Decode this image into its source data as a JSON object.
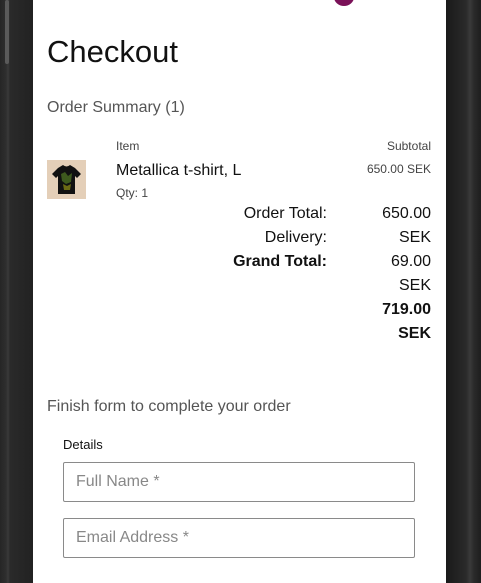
{
  "page": {
    "title": "Checkout",
    "order_summary_heading": "Order Summary (1)"
  },
  "order": {
    "columns": {
      "item": "Item",
      "subtotal": "Subtotal"
    },
    "items": [
      {
        "name": "Metallica t-shirt, L",
        "qty": "Qty: 1",
        "subtotal": "650.00 SEK",
        "image": "black-tshirt"
      }
    ],
    "totals": {
      "labels": [
        "Order Total:",
        "Delivery:",
        "Grand Total:"
      ],
      "value_lines": [
        "650.00",
        "SEK",
        "69.00",
        "SEK",
        "719.00",
        "SEK"
      ]
    }
  },
  "form": {
    "prompt": "Finish form to complete your order",
    "section_label": "Details",
    "full_name_placeholder": "Full Name *",
    "email_placeholder": "Email Address *",
    "full_name_value": "",
    "email_value": ""
  },
  "colors": {
    "cart_badge": "#7a1158",
    "page_background": "#ffffff",
    "frame": "#1e1e1e"
  },
  "icons": {
    "cart_badge": "cart-count-badge"
  }
}
